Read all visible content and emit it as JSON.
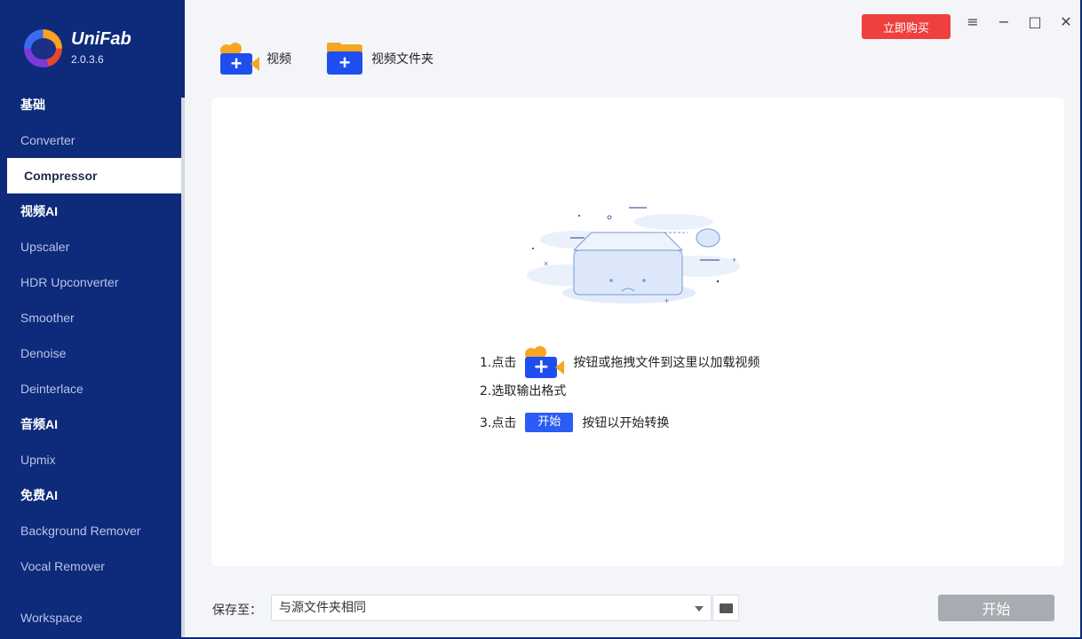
{
  "app": {
    "name": "UniFab",
    "version": "2.0.3.6"
  },
  "header": {
    "buy_label": "立即购买",
    "menu_icon": "≡",
    "minimize_icon": "−",
    "maximize_icon": "□",
    "close_icon": "✕"
  },
  "toolbar": {
    "add_video_label": "视频",
    "add_folder_label": "视频文件夹"
  },
  "sidebar": {
    "sections": [
      {
        "title": "基础",
        "items": [
          "Converter",
          "Compressor"
        ]
      },
      {
        "title": "视频AI",
        "items": [
          "Upscaler",
          "HDR Upconverter",
          "Smoother",
          "Denoise",
          "Deinterlace"
        ]
      },
      {
        "title": "音频AI",
        "items": [
          "Upmix"
        ]
      },
      {
        "title": "免费AI",
        "items": [
          "Background Remover",
          "Vocal Remover"
        ]
      }
    ],
    "active_item": "Compressor",
    "workspace_label": "Workspace"
  },
  "instructions": {
    "step1_prefix": "1.点击",
    "step1_suffix": "按钮或拖拽文件到这里以加载视频",
    "step2": "2.选取输出格式",
    "step3_prefix": "3.点击",
    "step3_button": "开始",
    "step3_suffix": "按钮以开始转换"
  },
  "footer": {
    "save_label": "保存至：",
    "save_value": "与源文件夹相同",
    "start_label": "开始"
  },
  "colors": {
    "sidebar_bg": "#0d2a7b",
    "buy_button": "#ef3f3f",
    "accent": "#1e4ef0",
    "start_disabled": "#a8abb2"
  }
}
